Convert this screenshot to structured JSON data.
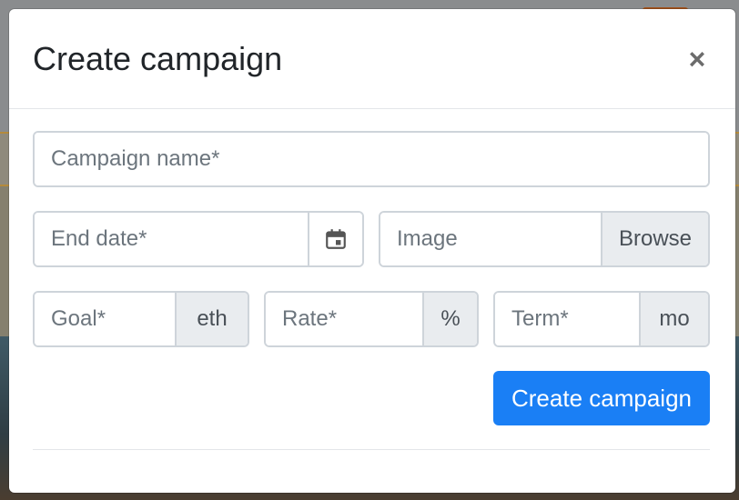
{
  "modal": {
    "title": "Create campaign",
    "close_label": "×"
  },
  "form": {
    "campaign_name": {
      "placeholder": "Campaign name*",
      "value": ""
    },
    "end_date": {
      "placeholder": "End date*",
      "value": "",
      "icon": "calendar-icon"
    },
    "image": {
      "placeholder": "Image",
      "value": "",
      "browse_label": "Browse"
    },
    "goal": {
      "placeholder": "Goal*",
      "value": "",
      "unit": "eth"
    },
    "rate": {
      "placeholder": "Rate*",
      "value": "",
      "unit": "%"
    },
    "term": {
      "placeholder": "Term*",
      "value": "",
      "unit": "mo"
    },
    "submit_label": "Create campaign"
  },
  "colors": {
    "primary": "#1a7ff5",
    "addon_bg": "#e9ecef",
    "border": "#ced4da"
  }
}
